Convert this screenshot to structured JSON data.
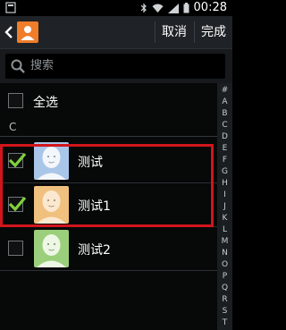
{
  "actionbar": {
    "cancel_label": "取消",
    "done_label": "完成"
  },
  "search": {
    "placeholder": "搜索"
  },
  "select_all": {
    "label": "全选",
    "checked": false
  },
  "section": {
    "header": "C"
  },
  "contacts": [
    {
      "name": "测试",
      "checked": true,
      "avatar_color": "#a9c6e8",
      "face_color": "#f3f6fb"
    },
    {
      "name": "测试1",
      "checked": true,
      "avatar_color": "#f0c07f",
      "face_color": "#fbe8d0"
    },
    {
      "name": "测试2",
      "checked": false,
      "avatar_color": "#9ccf7b",
      "face_color": "#eef7e6"
    }
  ],
  "status_bar": {
    "time": "00:28"
  },
  "index": [
    "#",
    "A",
    "B",
    "C",
    "D",
    "E",
    "F",
    "G",
    "H",
    "I",
    "J",
    "K",
    "L",
    "M",
    "N",
    "O",
    "P",
    "Q",
    "R",
    "S",
    "T"
  ],
  "colors": {
    "accent_check": "#7fd13b",
    "highlight_border": "#d2151c",
    "app_icon": "#ef7d2a"
  },
  "icons": {
    "status_left": "notification-icon",
    "status_right": [
      "bluetooth-icon",
      "wifi-icon",
      "signal-icon",
      "battery-icon"
    ]
  }
}
